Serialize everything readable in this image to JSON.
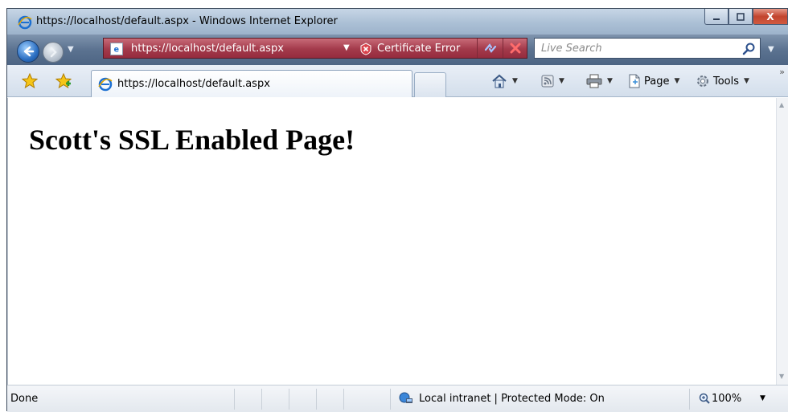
{
  "window": {
    "title": "https://localhost/default.aspx - Windows Internet Explorer",
    "close_label": "X"
  },
  "nav": {
    "address_url": "https://localhost/default.aspx",
    "certificate_error_label": "Certificate Error",
    "search_placeholder": "Live Search"
  },
  "command_bar": {
    "tab_title": "https://localhost/default.aspx",
    "page_label": "Page",
    "tools_label": "Tools"
  },
  "content": {
    "heading": "Scott's SSL Enabled Page!"
  },
  "status": {
    "text": "Done",
    "zone": "Local intranet | Protected Mode: On",
    "zoom": "100%"
  },
  "icons": {
    "browser": "ie-logo-icon",
    "back": "back-arrow-icon",
    "forward": "forward-arrow-icon",
    "certificate": "certificate-error-icon",
    "refresh": "refresh-icon",
    "stop": "stop-icon",
    "search": "search-icon",
    "favorites": "favorites-star-icon",
    "add_favorites": "add-favorites-icon",
    "home": "home-icon",
    "feeds": "feeds-icon",
    "print": "print-icon",
    "page": "page-icon",
    "tools": "tools-gear-icon",
    "zone": "intranet-zone-icon",
    "zoom": "zoom-icon"
  },
  "colors": {
    "address_bar_error": "#a33a4b",
    "nav_background": "#5b7290",
    "command_background": "#dbe4ef"
  }
}
